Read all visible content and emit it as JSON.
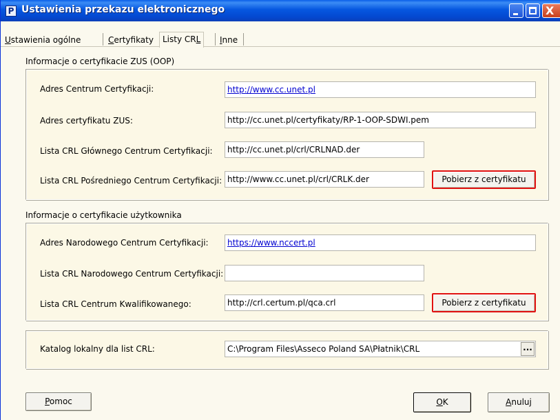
{
  "window": {
    "title": "Ustawienia przekazu elektronicznego",
    "icon_letter": "P",
    "minimize_icon": "minimize-icon",
    "maximize_icon": "maximize-icon",
    "close_icon": "close-icon",
    "close_glyph": "X"
  },
  "tabs": [
    {
      "prefix": "",
      "accel": "U",
      "rest": "stawienia ogólne",
      "active": false
    },
    {
      "prefix": "",
      "accel": "C",
      "rest": "ertyfikaty",
      "active": false
    },
    {
      "prefix": "Listy CR",
      "accel": "L",
      "rest": "",
      "active": true
    },
    {
      "prefix": "",
      "accel": "I",
      "rest": "nne",
      "active": false
    }
  ],
  "zus_group": {
    "title": "Informacje o certyfikacie ZUS (OOP)",
    "fields": [
      {
        "label": "Adres Centrum Certyfikacji:",
        "value": "http://www.cc.unet.pl"
      },
      {
        "label": "Adres certyfikatu ZUS:",
        "value": "http://cc.unet.pl/certyfikaty/RP-1-OOP-SDWI.pem"
      },
      {
        "label": "Lista CRL Głównego Centrum Certyfikacji:",
        "value": "http://cc.unet.pl/crl/CRLNAD.der"
      },
      {
        "label": "Lista CRL Pośredniego Centrum Certyfikacji:",
        "value": "http://www.cc.unet.pl/crl/CRLK.der"
      }
    ],
    "fetch_button": "Pobierz z certyfikatu"
  },
  "user_group": {
    "title": "Informacje o certyfikacie użytkownika",
    "fields": [
      {
        "label": "Adres Narodowego Centrum Certyfikacji:",
        "value": "https://www.nccert.pl"
      },
      {
        "label": "Lista CRL Narodowego Centrum Certyfikacji:",
        "value": ""
      },
      {
        "label": "Lista CRL Centrum Kwalifikowanego:",
        "value": "http://crl.certum.pl/qca.crl"
      }
    ],
    "fetch_button": "Pobierz z certyfikatu"
  },
  "catalog_group": {
    "label": "Katalog lokalny dla list CRL:",
    "value": "C:\\Program Files\\Asseco Poland SA\\Płatnik\\CRL",
    "browse_label": "..."
  },
  "buttons": {
    "help": {
      "accel": "P",
      "rest": "omoc"
    },
    "ok": {
      "accel": "O",
      "rest": "K"
    },
    "cancel": {
      "accel": "A",
      "rest": "nuluj"
    }
  }
}
